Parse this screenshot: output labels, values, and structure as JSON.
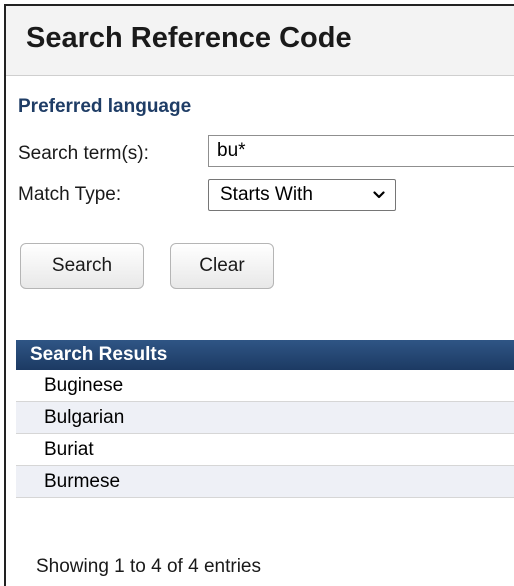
{
  "header": {
    "title": "Search Reference Code"
  },
  "form": {
    "section_label": "Preferred language",
    "search_label": "Search term(s):",
    "search_value": "bu*",
    "match_label": "Match Type:",
    "match_selected": "Starts With",
    "search_button": "Search",
    "clear_button": "Clear"
  },
  "results": {
    "header": "Search Results",
    "items": [
      "Buginese",
      "Bulgarian",
      "Buriat",
      "Burmese"
    ],
    "summary": "Showing 1 to 4 of 4 entries"
  },
  "icons": {
    "match_dropdown": "chevron-down-icon"
  },
  "colors": {
    "results_header_bg": "#1f3f6b",
    "section_label": "#1f3d66",
    "row_alt_bg": "#eef0f6"
  }
}
